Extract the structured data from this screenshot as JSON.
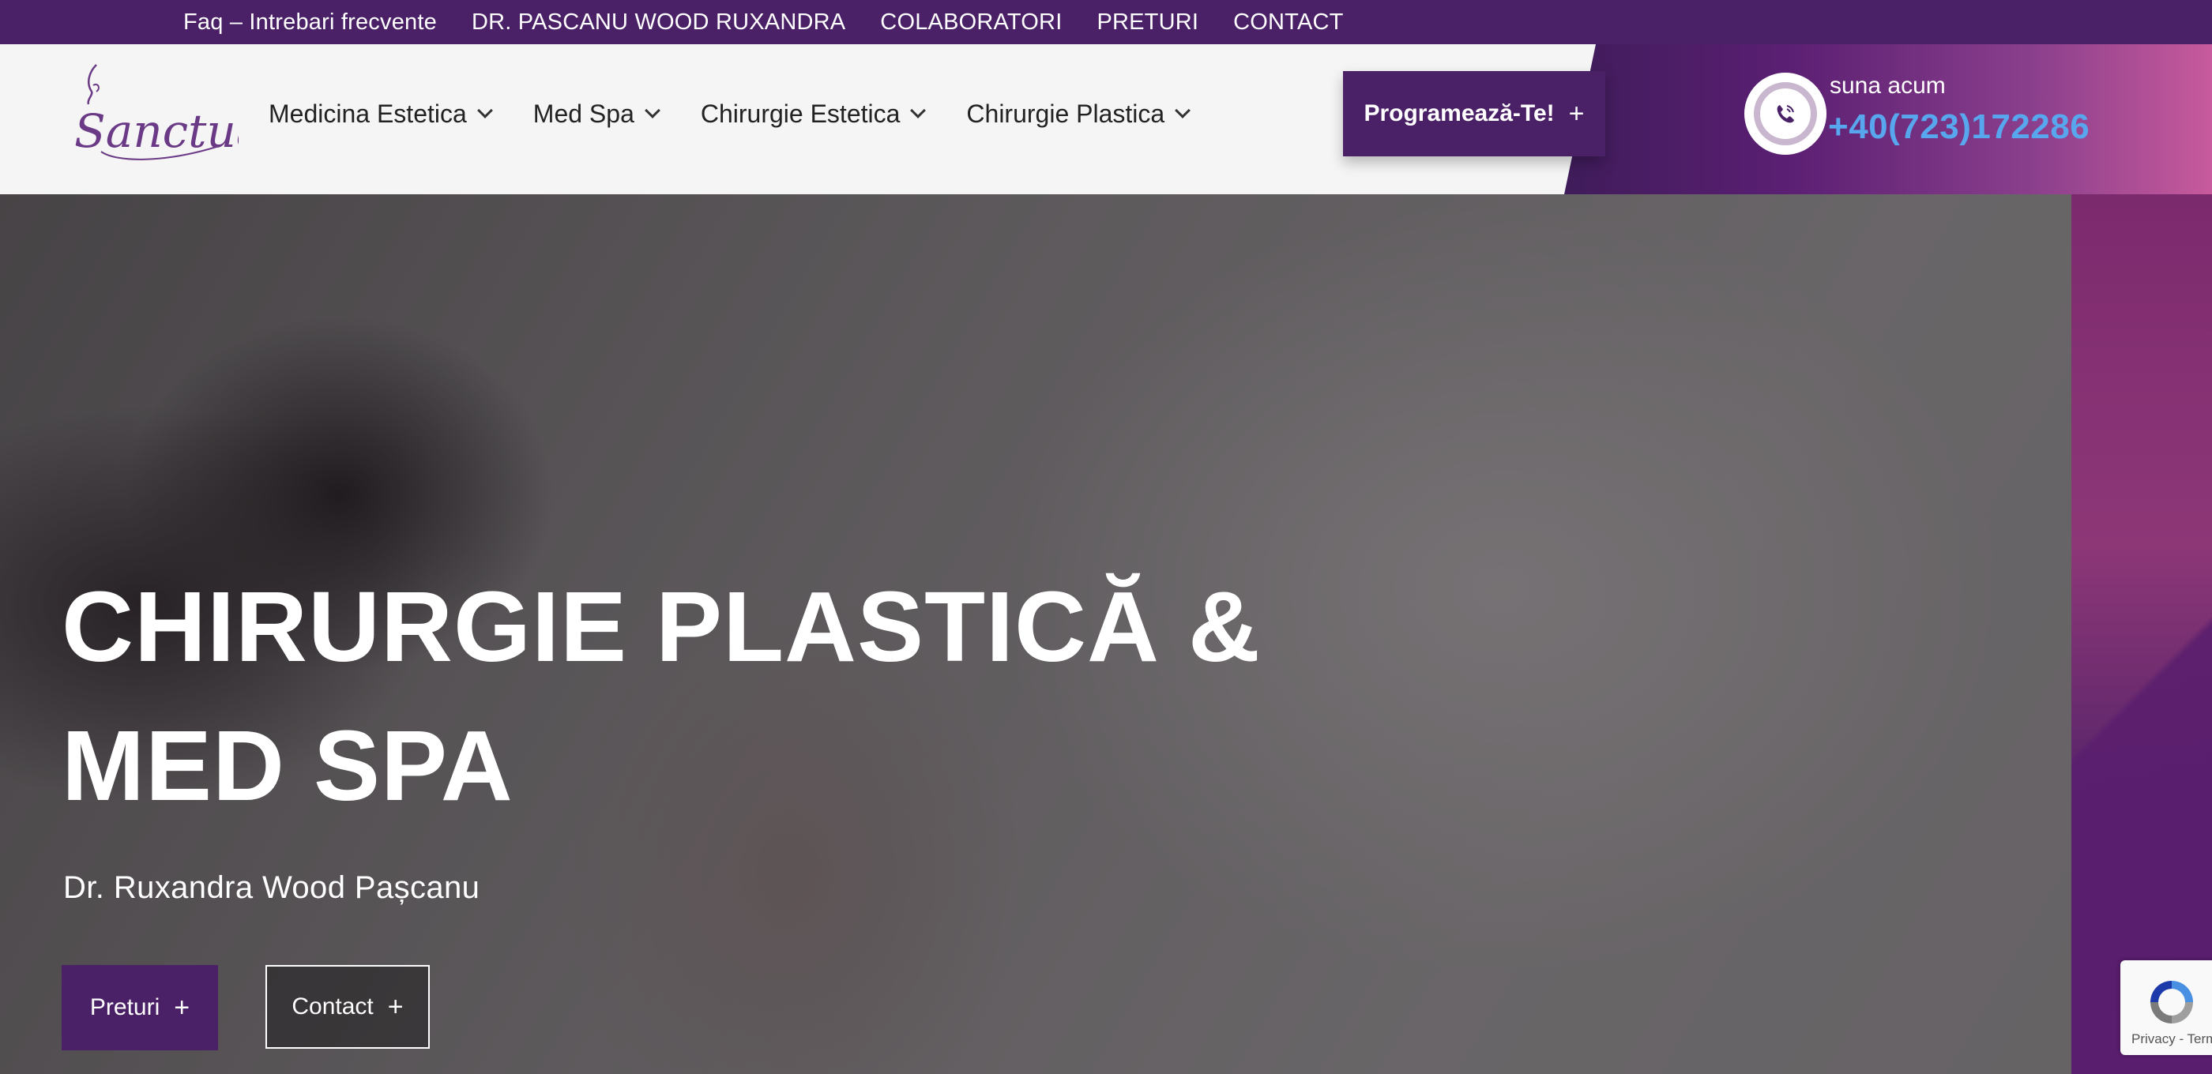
{
  "topbar": {
    "links": [
      "Faq – Intrebari frecvente",
      "DR. PASCANU WOOD RUXANDRA",
      "COLABORATORI",
      "PRETURI",
      "CONTACT"
    ]
  },
  "header": {
    "logo_text": "Sanctuary",
    "nav": [
      {
        "label": "Medicina Estetica"
      },
      {
        "label": "Med Spa"
      },
      {
        "label": "Chirurgie Estetica"
      },
      {
        "label": "Chirurgie Plastica"
      }
    ],
    "cta_label": "Programează-Te!",
    "call_label": "suna acum",
    "phone": "+40(723)172286"
  },
  "hero": {
    "title_line1": "CHIRURGIE PLASTICĂ &",
    "title_line2": "MED SPA",
    "subtitle": "Dr. Ruxandra Wood Pașcanu",
    "btn_preturi": "Preturi",
    "btn_contact": "Contact",
    "plus": "+"
  },
  "recaptcha": {
    "text": "Privacy - Terms"
  },
  "colors": {
    "brand_purple": "#4a2066",
    "phone_blue": "#57a6ee"
  }
}
